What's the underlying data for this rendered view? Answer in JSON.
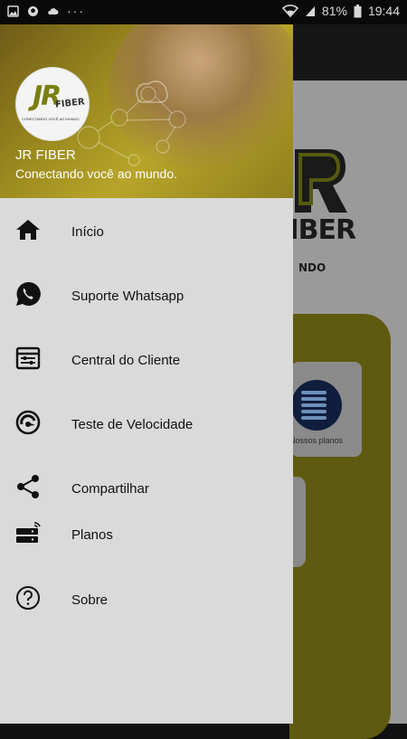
{
  "status_bar": {
    "battery": "81%",
    "time": "19:44",
    "dots": "···"
  },
  "drawer": {
    "header": {
      "title": "JR FIBER",
      "subtitle": "Conectando você ao mundo.",
      "logo_text": "JR",
      "logo_fiber": "FIBER",
      "logo_tagline": "CONECTANDO VOCÊ AO MUNDO"
    },
    "items": [
      {
        "label": "Início",
        "icon": "home-icon"
      },
      {
        "label": "Suporte Whatsapp",
        "icon": "whatsapp-icon"
      },
      {
        "label": "Central do Cliente",
        "icon": "client-center-icon"
      },
      {
        "label": "Teste de Velocidade",
        "icon": "speedometer-icon"
      },
      {
        "label": "Compartilhar",
        "icon": "share-icon"
      },
      {
        "label": "Planos",
        "icon": "router-icon"
      },
      {
        "label": "Sobre",
        "icon": "help-icon"
      }
    ]
  },
  "background": {
    "logo_text": "R",
    "logo_sub": "FIBER",
    "mundo_text": "NDO",
    "plans_label": "Nossos planos"
  },
  "colors": {
    "drawer_bg": "#dadada",
    "header_yellow": "#b7a52a",
    "text_dark": "#111111"
  }
}
